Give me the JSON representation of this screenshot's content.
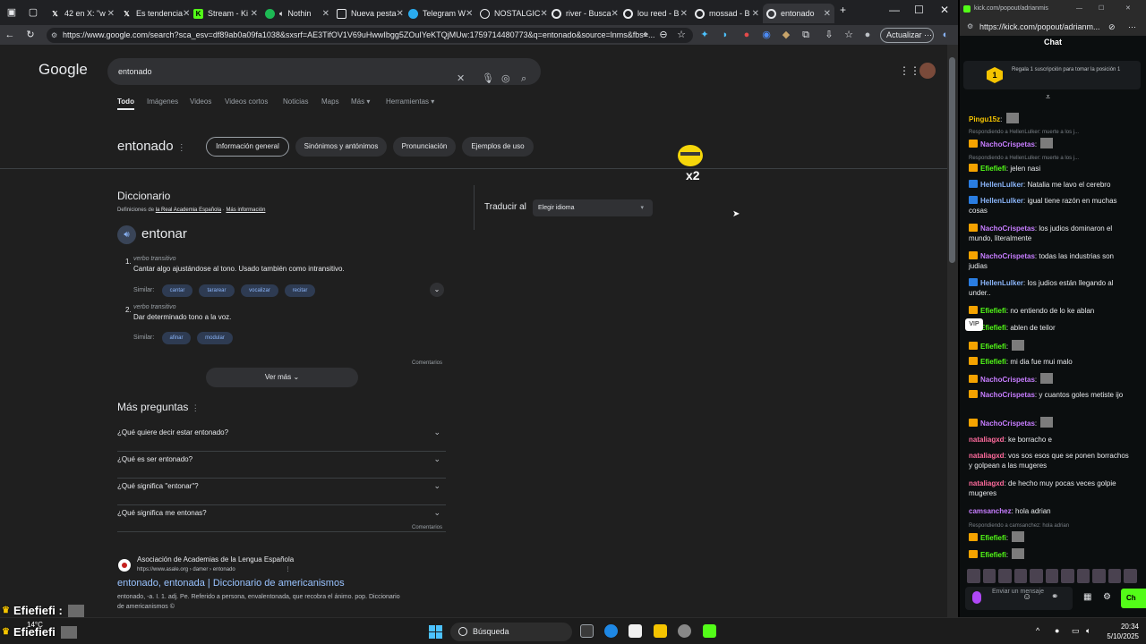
{
  "tabs": [
    {
      "label": "42 en X: \"w",
      "icon": "x-logo-icon"
    },
    {
      "label": "Es tendencia",
      "icon": "x-logo-icon"
    },
    {
      "label": "Stream - Ki",
      "icon": "kick-icon"
    },
    {
      "label": "Nothin",
      "icon": "spotify-icon"
    },
    {
      "label": "Nueva pesta",
      "icon": "new-tab-icon"
    },
    {
      "label": "Telegram W",
      "icon": "telegram-icon"
    },
    {
      "label": "NOSTALGIC",
      "icon": "globe-icon"
    },
    {
      "label": "river - Busca",
      "icon": "google-icon"
    },
    {
      "label": "lou reed - B",
      "icon": "google-icon"
    },
    {
      "label": "mossad - B",
      "icon": "google-icon"
    },
    {
      "label": "entonado",
      "icon": "google-icon"
    }
  ],
  "address_url": "https://www.google.com/search?sca_esv=df89ab0a09fa1038&sxsrf=AE3TifOV1V69uHwwIbgg5ZOuIYeKTQjMUw:1759714480773&q=entonado&source=lnms&fbs=...",
  "update_label": "Actualizar",
  "google": {
    "logo": "Google",
    "query": "entonado",
    "nav": [
      "Todo",
      "Imágenes",
      "Videos",
      "Videos cortos",
      "Noticias",
      "Maps",
      "Más",
      "Herramientas"
    ],
    "term": "entonado",
    "chips": [
      "Información general",
      "Sinónimos y antónimos",
      "Pronunciación",
      "Ejemplos de uso"
    ],
    "dict_heading": "Diccionario",
    "dict_source_prefix": "Definiciones de",
    "dict_source_link": "la Real Academia Española",
    "dict_more_info": "Más información",
    "headword": "entonar",
    "defs": [
      {
        "num": "1.",
        "pos": "verbo transitivo",
        "text": "Cantar algo ajustándose al tono. Usado también como intransitivo.",
        "similar": [
          "cantar",
          "tararear",
          "vocalizar",
          "recitar"
        ]
      },
      {
        "num": "2.",
        "pos": "verbo transitivo",
        "text": "Dar determinado tono a la voz.",
        "similar": [
          "afinar",
          "modular"
        ]
      }
    ],
    "similar_label": "Similar:",
    "see_more": "Ver más",
    "comments": "Comentarios",
    "translate_label": "Traducir al",
    "translate_select": "Elegir idioma",
    "more_questions": "Más preguntas",
    "faqs": [
      "¿Qué quiere decir estar entonado?",
      "¿Qué es ser entonado?",
      "¿Qué significa \"entonar\"?",
      "¿Qué significa me entonas?"
    ],
    "result": {
      "site": "Asociación de Academias de la Lengua Española",
      "url": "https://www.asale.org › damer › entonado",
      "title": "entonado, entonada | Diccionario de americanismos",
      "snippet_1": "entonado, -a. I. 1. adj. Pe. Referido a persona, envalentonada, que recobra el ánimo. pop. Diccionario",
      "snippet_2": "de americanismos ©"
    }
  },
  "stream_overlay": {
    "emote_count": "x2",
    "chat_user_1": "Efiefiefi :",
    "chat_user_2": "Efiefiefi"
  },
  "kick": {
    "title_url": "kick.com/popout/adrianmis",
    "url": "https://kick.com/popout/adrianm...",
    "header": "Chat",
    "pinned_position": "1",
    "pinned_text": "Regala 1 suscripción para tomar la posición 1",
    "vip": "VIP",
    "messages": [
      {
        "user": "Pingu15z",
        "text": "",
        "color": "#f5c400",
        "badge": "",
        "reply": ""
      },
      {
        "user": "NachoCrispetas",
        "text": "",
        "color": "#c77dff",
        "badge": "crown",
        "reply": "Respondiendo a HellenLulker: muerte a los j..."
      },
      {
        "user": "Efiefiefi",
        "text": "jelen nasi",
        "color": "#53fc18",
        "badge": "crown",
        "reply": "Respondiendo a HellenLulker: muerte a los j..."
      },
      {
        "user": "HellenLulker",
        "text": "Natalia me lavo el cerebro",
        "color": "#8ab4f8",
        "badge": "sub",
        "reply": ""
      },
      {
        "user": "HellenLulker",
        "text": "igual tiene razón en muchas cosas",
        "color": "#8ab4f8",
        "badge": "sub",
        "reply": ""
      },
      {
        "user": "NachoCrispetas",
        "text": "los judios dominaron el mundo, literalmente",
        "color": "#c77dff",
        "badge": "crown",
        "reply": ""
      },
      {
        "user": "NachoCrispetas",
        "text": "todas las industrias son judias",
        "color": "#c77dff",
        "badge": "crown",
        "reply": ""
      },
      {
        "user": "HellenLulker",
        "text": "los judios están llegando al under..",
        "color": "#8ab4f8",
        "badge": "sub",
        "reply": ""
      },
      {
        "user": "Efiefiefi",
        "text": "no entiendo de lo ke ablan",
        "color": "#53fc18",
        "badge": "crown",
        "reply": ""
      },
      {
        "user": "Efiefiefi",
        "text": "ablen de teilor",
        "color": "#53fc18",
        "badge": "crown",
        "reply": ""
      },
      {
        "user": "Efiefiefi",
        "text": "",
        "color": "#53fc18",
        "badge": "crown",
        "reply": ""
      },
      {
        "user": "Efiefiefi",
        "text": "mi dia fue mui malo",
        "color": "#53fc18",
        "badge": "crown",
        "reply": ""
      },
      {
        "user": "NachoCrispetas",
        "text": "",
        "color": "#c77dff",
        "badge": "crown",
        "reply": ""
      },
      {
        "user": "NachoCrispetas",
        "text": "y cuantos goles metiste ijo",
        "color": "#c77dff",
        "badge": "crown",
        "reply": ""
      },
      {
        "user": "NachoCrispetas",
        "text": "",
        "color": "#c77dff",
        "badge": "crown",
        "reply": ""
      },
      {
        "user": "nataliagxd",
        "text": "ke borracho e",
        "color": "#ff6b9d",
        "badge": "",
        "reply": ""
      },
      {
        "user": "nataliagxd",
        "text": "vos sos esos que se ponen borrachos y golpean a las mugeres",
        "color": "#ff6b9d",
        "badge": "",
        "reply": ""
      },
      {
        "user": "nataliagxd",
        "text": "de hecho muy pocas veces golpie mugeres",
        "color": "#ff6b9d",
        "badge": "",
        "reply": ""
      },
      {
        "user": "camsanchez",
        "text": "hola adrian",
        "color": "#c77dff",
        "badge": "",
        "reply": ""
      },
      {
        "user": "Efiefiefi",
        "text": "",
        "color": "#53fc18",
        "badge": "crown",
        "reply": "Respondiendo a camsanchez: hola adrian"
      },
      {
        "user": "Efiefiefi",
        "text": "",
        "color": "#53fc18",
        "badge": "crown",
        "reply": ""
      }
    ],
    "input_placeholder": "Enviar un mensaje",
    "send_label": "Ch"
  },
  "taskbar": {
    "weather_temp": "14°C",
    "search": "Búsqueda",
    "time": "20:34",
    "date": "5/10/2025"
  }
}
